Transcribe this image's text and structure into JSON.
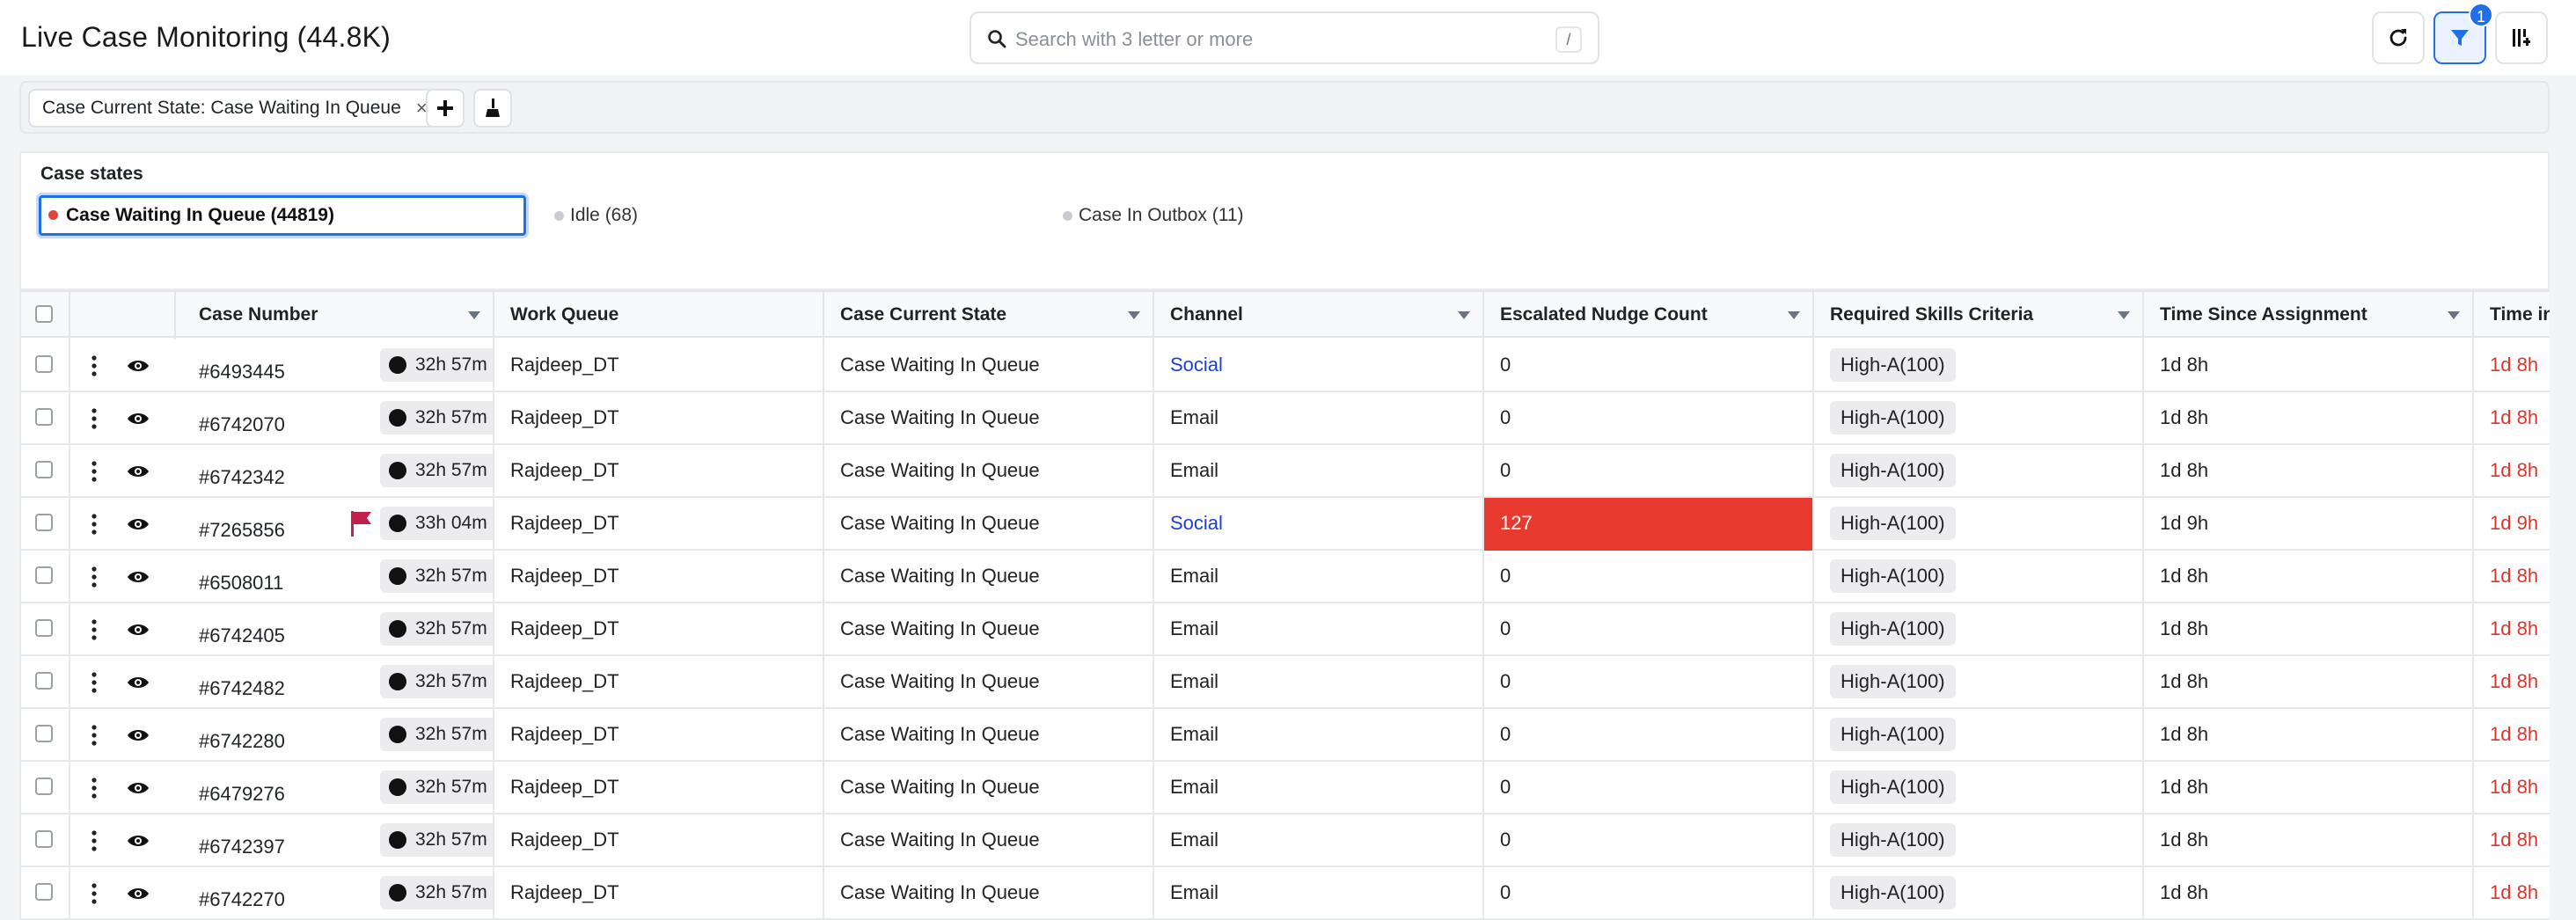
{
  "header": {
    "title": "Live Case Monitoring (44.8K)",
    "search_placeholder": "Search with 3 letter or more",
    "search_shortcut": "/",
    "filter_badge": "1"
  },
  "filters": {
    "chip_label": "Case Current State: Case Waiting In Queue",
    "chip_close": "×",
    "add_label": "+"
  },
  "case_states": {
    "label": "Case states",
    "options": [
      {
        "label": "Case Waiting In Queue (44819)",
        "selected": true
      },
      {
        "label": "Idle (68)",
        "selected": false
      },
      {
        "label": "Case In Outbox (11)",
        "selected": false
      }
    ]
  },
  "table": {
    "columns": [
      "Case Number",
      "Work Queue",
      "Case Current State",
      "Channel",
      "Escalated Nudge Count",
      "Required Skills Criteria",
      "Time Since Assignment",
      "Time in"
    ],
    "rows": [
      {
        "case": "#6493445",
        "timer": "32h 57m",
        "flag": false,
        "queue": "Rajdeep_DT",
        "state": "Case Waiting In Queue",
        "channel": "Social",
        "nudge": "0",
        "skill": "High-A(100)",
        "since": "1d 8h",
        "timein": "1d 8h"
      },
      {
        "case": "#6742070",
        "timer": "32h 57m",
        "flag": false,
        "queue": "Rajdeep_DT",
        "state": "Case Waiting In Queue",
        "channel": "Email",
        "nudge": "0",
        "skill": "High-A(100)",
        "since": "1d 8h",
        "timein": "1d 8h"
      },
      {
        "case": "#6742342",
        "timer": "32h 57m",
        "flag": false,
        "queue": "Rajdeep_DT",
        "state": "Case Waiting In Queue",
        "channel": "Email",
        "nudge": "0",
        "skill": "High-A(100)",
        "since": "1d 8h",
        "timein": "1d 8h"
      },
      {
        "case": "#7265856",
        "timer": "33h 04m",
        "flag": true,
        "queue": "Rajdeep_DT",
        "state": "Case Waiting In Queue",
        "channel": "Social",
        "nudge": "127",
        "skill": "High-A(100)",
        "since": "1d 9h",
        "timein": "1d 9h"
      },
      {
        "case": "#6508011",
        "timer": "32h 57m",
        "flag": false,
        "queue": "Rajdeep_DT",
        "state": "Case Waiting In Queue",
        "channel": "Email",
        "nudge": "0",
        "skill": "High-A(100)",
        "since": "1d 8h",
        "timein": "1d 8h"
      },
      {
        "case": "#6742405",
        "timer": "32h 57m",
        "flag": false,
        "queue": "Rajdeep_DT",
        "state": "Case Waiting In Queue",
        "channel": "Email",
        "nudge": "0",
        "skill": "High-A(100)",
        "since": "1d 8h",
        "timein": "1d 8h"
      },
      {
        "case": "#6742482",
        "timer": "32h 57m",
        "flag": false,
        "queue": "Rajdeep_DT",
        "state": "Case Waiting In Queue",
        "channel": "Email",
        "nudge": "0",
        "skill": "High-A(100)",
        "since": "1d 8h",
        "timein": "1d 8h"
      },
      {
        "case": "#6742280",
        "timer": "32h 57m",
        "flag": false,
        "queue": "Rajdeep_DT",
        "state": "Case Waiting In Queue",
        "channel": "Email",
        "nudge": "0",
        "skill": "High-A(100)",
        "since": "1d 8h",
        "timein": "1d 8h"
      },
      {
        "case": "#6479276",
        "timer": "32h 57m",
        "flag": false,
        "queue": "Rajdeep_DT",
        "state": "Case Waiting In Queue",
        "channel": "Email",
        "nudge": "0",
        "skill": "High-A(100)",
        "since": "1d 8h",
        "timein": "1d 8h"
      },
      {
        "case": "#6742397",
        "timer": "32h 57m",
        "flag": false,
        "queue": "Rajdeep_DT",
        "state": "Case Waiting In Queue",
        "channel": "Email",
        "nudge": "0",
        "skill": "High-A(100)",
        "since": "1d 8h",
        "timein": "1d 8h"
      },
      {
        "case": "#6742270",
        "timer": "32h 57m",
        "flag": false,
        "queue": "Rajdeep_DT",
        "state": "Case Waiting In Queue",
        "channel": "Email",
        "nudge": "0",
        "skill": "High-A(100)",
        "since": "1d 8h",
        "timein": "1d 8h"
      }
    ]
  },
  "colors": {
    "accent": "#1e6fe8",
    "escalated": "#e8392f",
    "overdue_text": "#e0342a",
    "social_link": "#1a3fd6",
    "flag": "#c0204a"
  },
  "icons": [
    "search-icon",
    "refresh-icon",
    "filter-icon",
    "columns-icon",
    "add-icon",
    "broom-icon",
    "more-vertical-icon",
    "eye-icon",
    "chat-icon",
    "flag-icon",
    "chevron-down-icon"
  ]
}
